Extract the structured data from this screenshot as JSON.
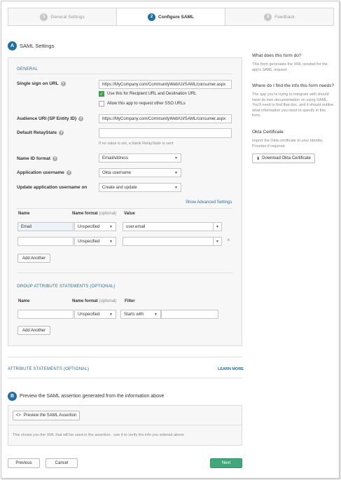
{
  "steps": [
    {
      "num": "1",
      "label": "General Settings"
    },
    {
      "num": "2",
      "label": "Configure SAML"
    },
    {
      "num": "3",
      "label": "Feedback"
    }
  ],
  "section_a": {
    "badge": "A",
    "title": "SAML Settings",
    "general_title": "GENERAL",
    "sso_url_label": "Single sign on URL",
    "sso_url_value": "https://MyCompany.com/CommunityWeb/UI/SAML/consumer.aspx",
    "recipient_checkbox_label": "Use this for Recipient URL and Destination URL",
    "other_sso_checkbox_label": "Allow this app to request other SSO URLs",
    "audience_label": "Audience URI (SP Entity ID)",
    "audience_value": "https://MyCompany.com/CommunityWeb/UI/SAML/consumer.aspx",
    "relay_label": "Default RelayState",
    "relay_value": "",
    "relay_hint": "If no value is set, a blank RelayState is sent",
    "name_id_label": "Name ID format",
    "name_id_value": "EmailAddress",
    "app_username_label": "Application username",
    "app_username_value": "Okta username",
    "update_label": "Update application username on",
    "update_value": "Create and update",
    "advanced_link": "Show Advanced Settings",
    "attr_headers": {
      "name": "Name",
      "format": "Name format",
      "format_opt": "(optional)",
      "value": "Value"
    },
    "attr_rows": [
      {
        "name": "Email",
        "format": "Unspecified",
        "value": "user.email"
      },
      {
        "name": "",
        "format": "Unspecified",
        "value": ""
      }
    ],
    "remove_icon": "×",
    "add_another": "Add Another",
    "group_title": "GROUP ATTRIBUTE STATEMENTS (OPTIONAL)",
    "group_headers": {
      "name": "Name",
      "format": "Name format",
      "format_opt": "(optional)",
      "filter": "Filter"
    },
    "group_row": {
      "name": "",
      "format": "Unspecified",
      "filter_type": "Starts with",
      "filter_value": ""
    },
    "group_add_another": "Add Another"
  },
  "attribute_statements": {
    "title": "ATTRIBUTE STATEMENTS (OPTIONAL)",
    "learn_more": "LEARN MORE"
  },
  "section_b": {
    "badge": "B",
    "title": "Preview the SAML assertion generated from the information above",
    "button": "Preview the SAML Assertion",
    "button_icon": "code-icon",
    "note": "This shows you the XML that will be used in the assertion - use it to verify the info you entered above"
  },
  "footer": {
    "previous": "Previous",
    "cancel": "Cancel",
    "next": "Next"
  },
  "sidebar": {
    "q1_title": "What does this form do?",
    "q1_text": "This form generates the XML needed for the app's SAML request.",
    "q2_title": "Where do I find the info this form needs?",
    "q2_text": "The app you're trying to integrate with should have its own documentation on using SAML. You'll need to find that doc, and it should outline what information you need to specify in this form.",
    "cert_title": "Okta Certificate",
    "cert_text": "Import the Okta certificate to your Identity Provider if required.",
    "cert_button": "Download Okta Certificate"
  },
  "colors": {
    "accent": "#1d6fa5",
    "primary_button": "#3fa878",
    "checked": "#3da24e"
  }
}
